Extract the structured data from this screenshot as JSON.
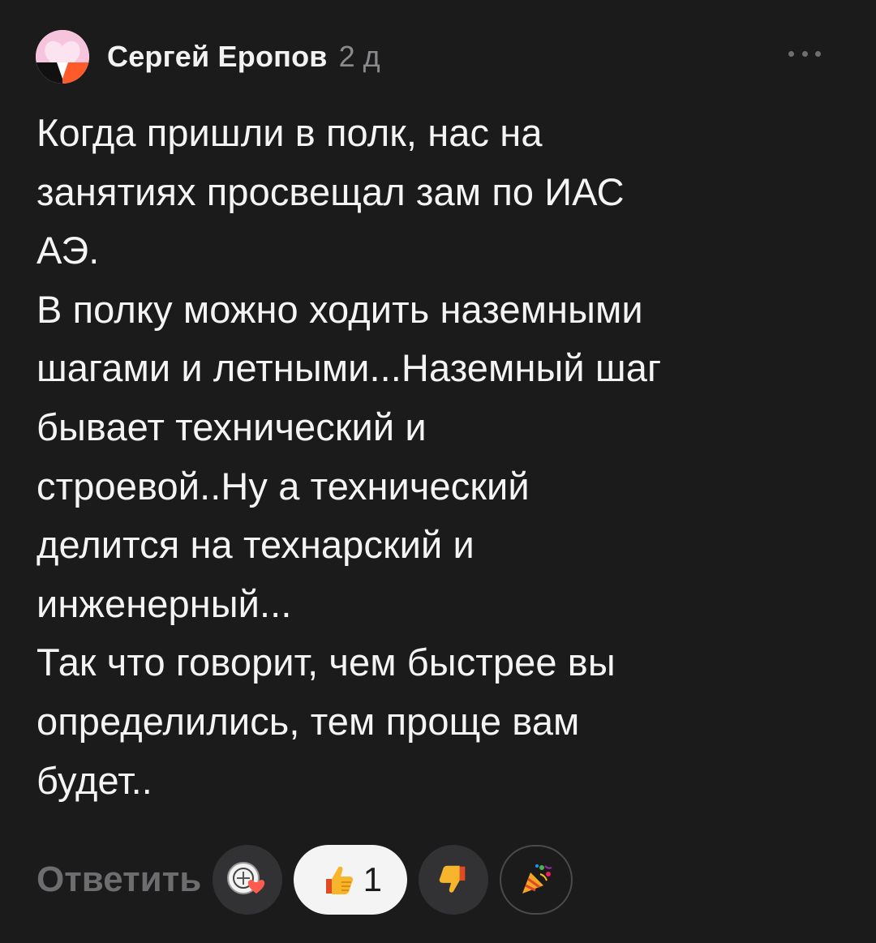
{
  "comment": {
    "author": "Сергей Еропов",
    "time": "2 д",
    "more_icon": "more-horizontal-icon",
    "text_lines": [
      "Когда пришли в полк, нас на",
      "занятиях просвещал зам по ИАС",
      "АЭ.",
      "В полку можно ходить наземными",
      "шагами и летными...Наземный шаг",
      "бывает технический и",
      "строевой..Ну а технический",
      "делится на технарский и",
      "инженерный...",
      "Так что говорит, чем быстрее вы",
      "определились, тем проще вам",
      "будет.."
    ]
  },
  "actions": {
    "reply_label": "Ответить",
    "reactions": [
      {
        "icon": "emblem-heart-icon",
        "count": ""
      },
      {
        "icon": "thumbs-up-icon",
        "count": "1"
      },
      {
        "icon": "thumbs-down-icon",
        "count": ""
      },
      {
        "icon": "party-popper-icon",
        "count": ""
      }
    ]
  },
  "colors": {
    "background": "#1b1b1c",
    "text": "#f4f4f4",
    "muted": "#8a8a8d",
    "selected_reaction_bg": "#f4f4f4"
  }
}
